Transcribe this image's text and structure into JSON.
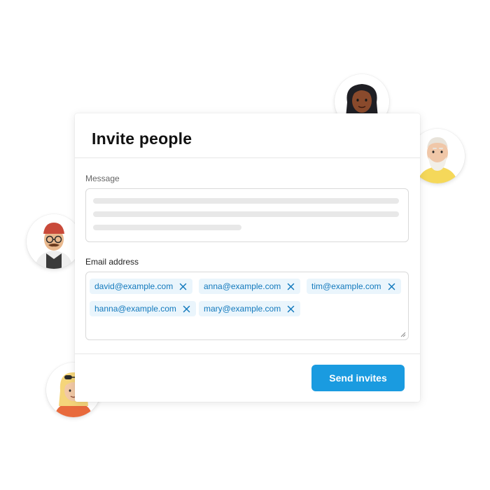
{
  "dialog": {
    "title": "Invite people",
    "message_label": "Message",
    "email_label": "Email address",
    "send_button_label": "Send invites"
  },
  "emails": [
    "david@example.com",
    "anna@example.com",
    "tim@example.com",
    "hanna@example.com",
    "mary@example.com"
  ],
  "colors": {
    "accent": "#1a9be0",
    "chip_background": "#eaf5fc",
    "chip_text": "#1279bd"
  },
  "icons": {
    "chip_remove": "close-icon",
    "textarea_resize": "resize-handle-icon"
  }
}
